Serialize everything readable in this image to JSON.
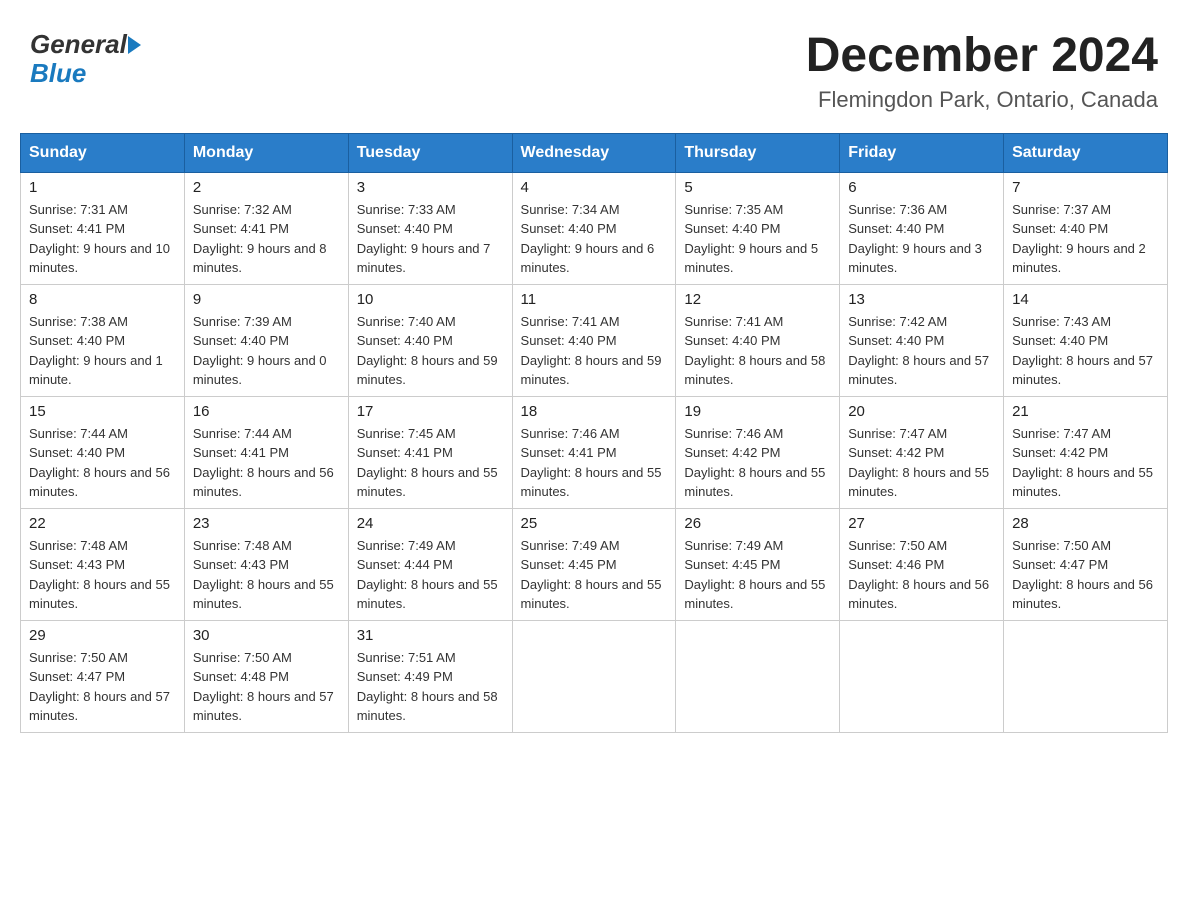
{
  "header": {
    "logo_general": "General",
    "logo_blue": "Blue",
    "month_title": "December 2024",
    "location": "Flemingdon Park, Ontario, Canada"
  },
  "days_of_week": [
    "Sunday",
    "Monday",
    "Tuesday",
    "Wednesday",
    "Thursday",
    "Friday",
    "Saturday"
  ],
  "weeks": [
    [
      {
        "day": "1",
        "sunrise": "7:31 AM",
        "sunset": "4:41 PM",
        "daylight": "9 hours and 10 minutes."
      },
      {
        "day": "2",
        "sunrise": "7:32 AM",
        "sunset": "4:41 PM",
        "daylight": "9 hours and 8 minutes."
      },
      {
        "day": "3",
        "sunrise": "7:33 AM",
        "sunset": "4:40 PM",
        "daylight": "9 hours and 7 minutes."
      },
      {
        "day": "4",
        "sunrise": "7:34 AM",
        "sunset": "4:40 PM",
        "daylight": "9 hours and 6 minutes."
      },
      {
        "day": "5",
        "sunrise": "7:35 AM",
        "sunset": "4:40 PM",
        "daylight": "9 hours and 5 minutes."
      },
      {
        "day": "6",
        "sunrise": "7:36 AM",
        "sunset": "4:40 PM",
        "daylight": "9 hours and 3 minutes."
      },
      {
        "day": "7",
        "sunrise": "7:37 AM",
        "sunset": "4:40 PM",
        "daylight": "9 hours and 2 minutes."
      }
    ],
    [
      {
        "day": "8",
        "sunrise": "7:38 AM",
        "sunset": "4:40 PM",
        "daylight": "9 hours and 1 minute."
      },
      {
        "day": "9",
        "sunrise": "7:39 AM",
        "sunset": "4:40 PM",
        "daylight": "9 hours and 0 minutes."
      },
      {
        "day": "10",
        "sunrise": "7:40 AM",
        "sunset": "4:40 PM",
        "daylight": "8 hours and 59 minutes."
      },
      {
        "day": "11",
        "sunrise": "7:41 AM",
        "sunset": "4:40 PM",
        "daylight": "8 hours and 59 minutes."
      },
      {
        "day": "12",
        "sunrise": "7:41 AM",
        "sunset": "4:40 PM",
        "daylight": "8 hours and 58 minutes."
      },
      {
        "day": "13",
        "sunrise": "7:42 AM",
        "sunset": "4:40 PM",
        "daylight": "8 hours and 57 minutes."
      },
      {
        "day": "14",
        "sunrise": "7:43 AM",
        "sunset": "4:40 PM",
        "daylight": "8 hours and 57 minutes."
      }
    ],
    [
      {
        "day": "15",
        "sunrise": "7:44 AM",
        "sunset": "4:40 PM",
        "daylight": "8 hours and 56 minutes."
      },
      {
        "day": "16",
        "sunrise": "7:44 AM",
        "sunset": "4:41 PM",
        "daylight": "8 hours and 56 minutes."
      },
      {
        "day": "17",
        "sunrise": "7:45 AM",
        "sunset": "4:41 PM",
        "daylight": "8 hours and 55 minutes."
      },
      {
        "day": "18",
        "sunrise": "7:46 AM",
        "sunset": "4:41 PM",
        "daylight": "8 hours and 55 minutes."
      },
      {
        "day": "19",
        "sunrise": "7:46 AM",
        "sunset": "4:42 PM",
        "daylight": "8 hours and 55 minutes."
      },
      {
        "day": "20",
        "sunrise": "7:47 AM",
        "sunset": "4:42 PM",
        "daylight": "8 hours and 55 minutes."
      },
      {
        "day": "21",
        "sunrise": "7:47 AM",
        "sunset": "4:42 PM",
        "daylight": "8 hours and 55 minutes."
      }
    ],
    [
      {
        "day": "22",
        "sunrise": "7:48 AM",
        "sunset": "4:43 PM",
        "daylight": "8 hours and 55 minutes."
      },
      {
        "day": "23",
        "sunrise": "7:48 AM",
        "sunset": "4:43 PM",
        "daylight": "8 hours and 55 minutes."
      },
      {
        "day": "24",
        "sunrise": "7:49 AM",
        "sunset": "4:44 PM",
        "daylight": "8 hours and 55 minutes."
      },
      {
        "day": "25",
        "sunrise": "7:49 AM",
        "sunset": "4:45 PM",
        "daylight": "8 hours and 55 minutes."
      },
      {
        "day": "26",
        "sunrise": "7:49 AM",
        "sunset": "4:45 PM",
        "daylight": "8 hours and 55 minutes."
      },
      {
        "day": "27",
        "sunrise": "7:50 AM",
        "sunset": "4:46 PM",
        "daylight": "8 hours and 56 minutes."
      },
      {
        "day": "28",
        "sunrise": "7:50 AM",
        "sunset": "4:47 PM",
        "daylight": "8 hours and 56 minutes."
      }
    ],
    [
      {
        "day": "29",
        "sunrise": "7:50 AM",
        "sunset": "4:47 PM",
        "daylight": "8 hours and 57 minutes."
      },
      {
        "day": "30",
        "sunrise": "7:50 AM",
        "sunset": "4:48 PM",
        "daylight": "8 hours and 57 minutes."
      },
      {
        "day": "31",
        "sunrise": "7:51 AM",
        "sunset": "4:49 PM",
        "daylight": "8 hours and 58 minutes."
      },
      null,
      null,
      null,
      null
    ]
  ],
  "labels": {
    "sunrise": "Sunrise:",
    "sunset": "Sunset:",
    "daylight": "Daylight:"
  }
}
